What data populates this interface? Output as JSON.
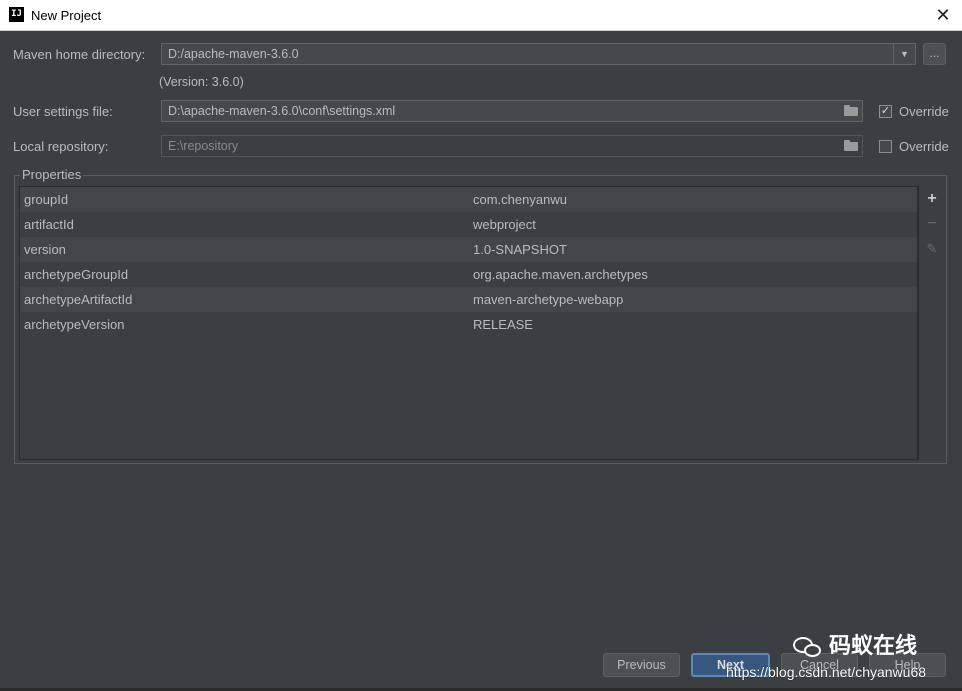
{
  "window": {
    "title": "New Project",
    "icon_text": "IJ"
  },
  "maven_home": {
    "label": "Maven home directory:",
    "value": "D:/apache-maven-3.6.0",
    "version_text": "(Version: 3.6.0)",
    "browse_label": "..."
  },
  "user_settings": {
    "label": "User settings file:",
    "value": "D:\\apache-maven-3.6.0\\conf\\settings.xml",
    "override_label": "Override",
    "override_checked": true
  },
  "local_repo": {
    "label": "Local repository:",
    "value": "E:\\repository",
    "override_label": "Override",
    "override_checked": false
  },
  "properties": {
    "title": "Properties",
    "rows": [
      {
        "key": "groupId",
        "value": "com.chenyanwu"
      },
      {
        "key": "artifactId",
        "value": "webproject"
      },
      {
        "key": "version",
        "value": "1.0-SNAPSHOT"
      },
      {
        "key": "archetypeGroupId",
        "value": "org.apache.maven.archetypes"
      },
      {
        "key": "archetypeArtifactId",
        "value": "maven-archetype-webapp"
      },
      {
        "key": "archetypeVersion",
        "value": "RELEASE"
      }
    ],
    "tools": {
      "add": "+",
      "remove": "−",
      "edit": "✎"
    }
  },
  "buttons": {
    "previous": "Previous",
    "next": "Next",
    "cancel": "Cancel",
    "help": "Help"
  },
  "watermark": {
    "brand": "码蚁在线",
    "url": "https://blog.csdn.net/chyanwu68"
  }
}
